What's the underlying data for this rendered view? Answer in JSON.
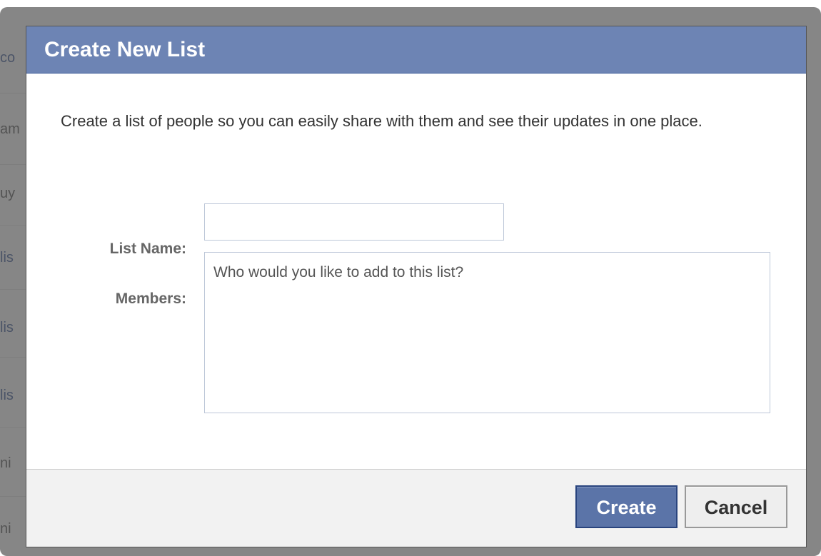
{
  "background": {
    "rows": [
      {
        "text": "co",
        "color": "link"
      },
      {
        "text": "am",
        "color": "gray"
      },
      {
        "text": "uy",
        "color": "gray"
      },
      {
        "text": "lis",
        "color": "link"
      },
      {
        "text": "lis",
        "color": "link"
      },
      {
        "text": "lis",
        "color": "link"
      },
      {
        "text": "ni",
        "color": "gray"
      },
      {
        "text": "ni",
        "color": "gray"
      }
    ]
  },
  "dialog": {
    "title": "Create New List",
    "description": "Create a list of people so you can easily share with them and see their updates in one place.",
    "fields": {
      "list_name": {
        "label": "List Name:",
        "value": "",
        "placeholder": ""
      },
      "members": {
        "label": "Members:",
        "value": "",
        "placeholder": "Who would you like to add to this list?"
      }
    },
    "buttons": {
      "create": "Create",
      "cancel": "Cancel"
    }
  },
  "colors": {
    "header_bg": "#6d84b4",
    "primary_button": "#5b74a8",
    "link": "#3b5998"
  }
}
